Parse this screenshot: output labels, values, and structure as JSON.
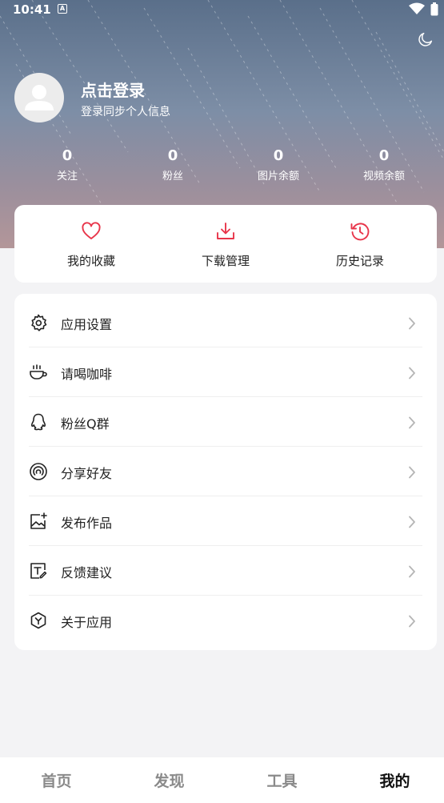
{
  "status_bar": {
    "time": "10:41",
    "badge": "A"
  },
  "profile": {
    "title": "点击登录",
    "subtitle": "登录同步个人信息"
  },
  "stats": [
    {
      "value": "0",
      "label": "关注"
    },
    {
      "value": "0",
      "label": "粉丝"
    },
    {
      "value": "0",
      "label": "图片余额"
    },
    {
      "value": "0",
      "label": "视频余额"
    }
  ],
  "quick_actions": [
    {
      "label": "我的收藏",
      "icon": "heart-icon"
    },
    {
      "label": "下载管理",
      "icon": "download-icon"
    },
    {
      "label": "历史记录",
      "icon": "history-icon"
    }
  ],
  "menu": [
    {
      "label": "应用设置",
      "icon": "gear-icon"
    },
    {
      "label": "请喝咖啡",
      "icon": "coffee-icon"
    },
    {
      "label": "粉丝Q群",
      "icon": "qq-icon"
    },
    {
      "label": "分享好友",
      "icon": "share-signal-icon"
    },
    {
      "label": "发布作品",
      "icon": "image-add-icon"
    },
    {
      "label": "反馈建议",
      "icon": "feedback-edit-icon"
    },
    {
      "label": "关于应用",
      "icon": "hexagon-icon"
    }
  ],
  "tabs": [
    {
      "label": "首页"
    },
    {
      "label": "发现"
    },
    {
      "label": "工具"
    },
    {
      "label": "我的"
    }
  ],
  "active_tab": "我的",
  "colors": {
    "accent": "#e8354a",
    "header_top": "#5a6f8a",
    "header_bottom": "#b39699"
  }
}
